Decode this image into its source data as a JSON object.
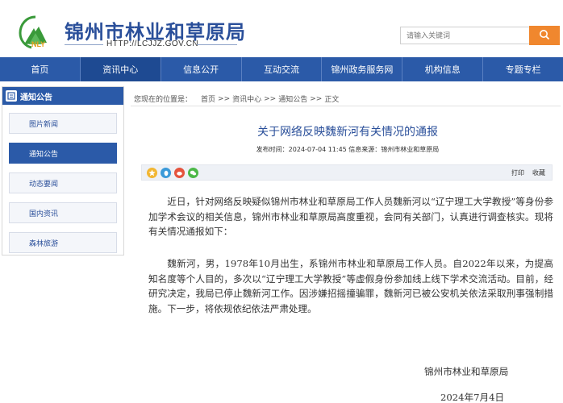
{
  "header": {
    "logo_text": "NLY",
    "title": "锦州市林业和草原局",
    "url": "HTTP://LCJJZ.GOV.CN",
    "search_placeholder": "请输入关键词"
  },
  "nav": {
    "items": [
      "首页",
      "资讯中心",
      "信息公开",
      "互动交流",
      "锦州政务服务网",
      "机构信息",
      "专题专栏"
    ]
  },
  "sidebar": {
    "header": "通知公告",
    "items": [
      "图片新闻",
      "通知公告",
      "动态要闻",
      "国内资讯",
      "森林旅游"
    ]
  },
  "breadcrumb": {
    "prefix": "您现在的位置是：",
    "items": [
      "首页",
      "资讯中心",
      "通知公告",
      "正文"
    ],
    "separator": ">>"
  },
  "article": {
    "title": "关于网络反映魏新河有关情况的通报",
    "meta": "发布时间：2024-07-04 11:45  信息来源：锦州市林业和草原局",
    "tools": [
      "打印",
      "收藏"
    ],
    "paragraphs": [
      "近日，针对网络反映疑似锦州市林业和草原局工作人员魏新河以“辽宁理工大学教授”等身份参加学术会议的相关信息，锦州市林业和草原局高度重视，会同有关部门，认真进行调查核实。现将有关情况通报如下：",
      "魏新河，男，1978年10月出生，系锦州市林业和草原局工作人员。自2022年以来，为提高知名度等个人目的，多次以“辽宁理工大学教授”等虚假身份参加线上线下学术交流活动。目前，经研究决定，我局已停止魏新河工作。因涉嫌招摇撞骗罪，魏新河已被公安机关依法采取刑事强制措施。下一步，将依规依纪依法严肃处理。"
    ],
    "signature": "锦州市林业和草原局",
    "date": "2024年7月4日"
  },
  "colors": {
    "brand_blue": "#2b5aa8",
    "search_orange": "#f0872e"
  }
}
